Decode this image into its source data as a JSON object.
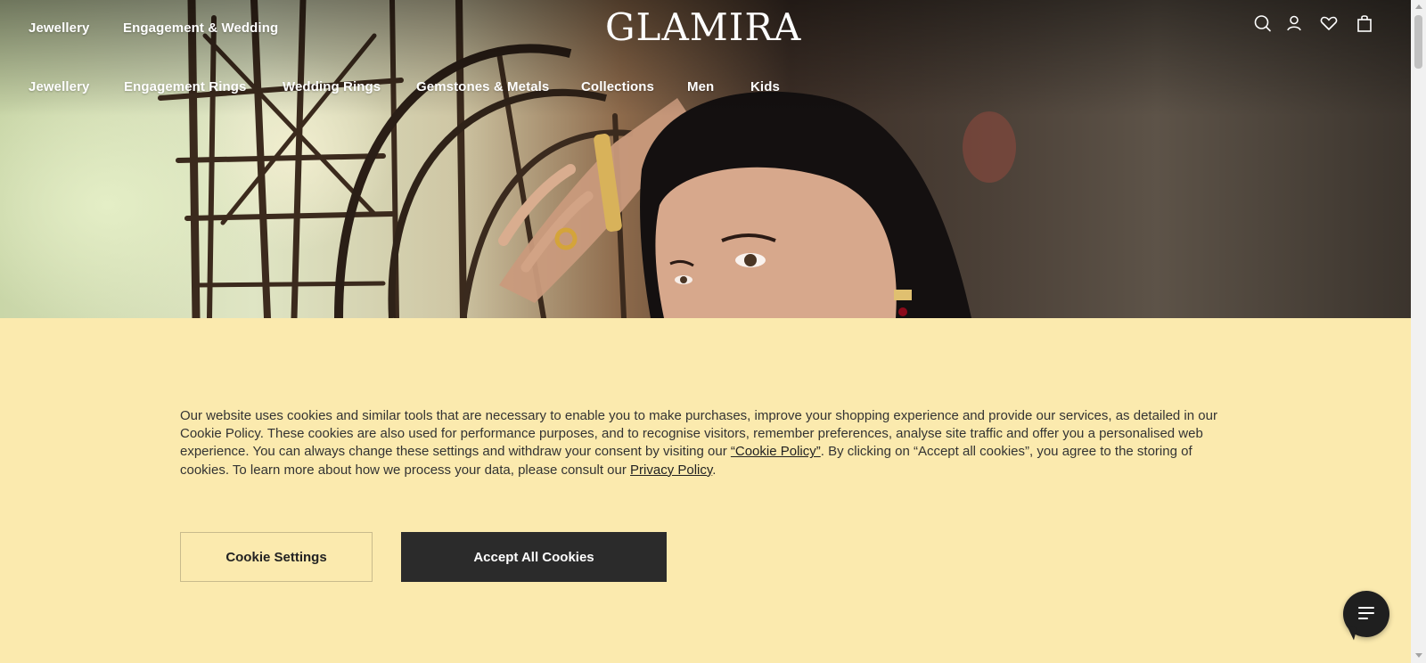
{
  "brand": {
    "logo": "GLAMIRA"
  },
  "top_nav": [
    "Jewellery",
    "Engagement & Wedding"
  ],
  "main_nav": [
    "Jewellery",
    "Engagement Rings",
    "Wedding Rings",
    "Gemstones & Metals",
    "Collections",
    "Men",
    "Kids"
  ],
  "header_icons": [
    "search-icon",
    "account-icon",
    "wishlist-icon",
    "cart-icon"
  ],
  "cookie_banner": {
    "text_part1": "Our website uses cookies and similar tools that are necessary to enable you to make purchases, improve your shopping experience and provide our services, as detailed in our Cookie Policy. These cookies are also used for performance purposes, and to recognise visitors, remember preferences, analyse site traffic and offer you a personalised web experience. You can always change these settings and withdraw your consent by visiting our ",
    "cookie_policy_link": "“Cookie Policy”",
    "text_part2": ". By clicking on “Accept all cookies”, you agree to the storing of cookies. To learn more about how we process your data, please consult our ",
    "privacy_policy_link": "Privacy Policy",
    "text_part3": ".",
    "settings_button": "Cookie Settings",
    "accept_button": "Accept All Cookies"
  },
  "colors": {
    "banner_background": "#fbeaae",
    "accept_button": "#2b2b2b",
    "chat_button": "#1f1f1f"
  },
  "chat_widget": {
    "icon": "chat-menu-icon"
  }
}
